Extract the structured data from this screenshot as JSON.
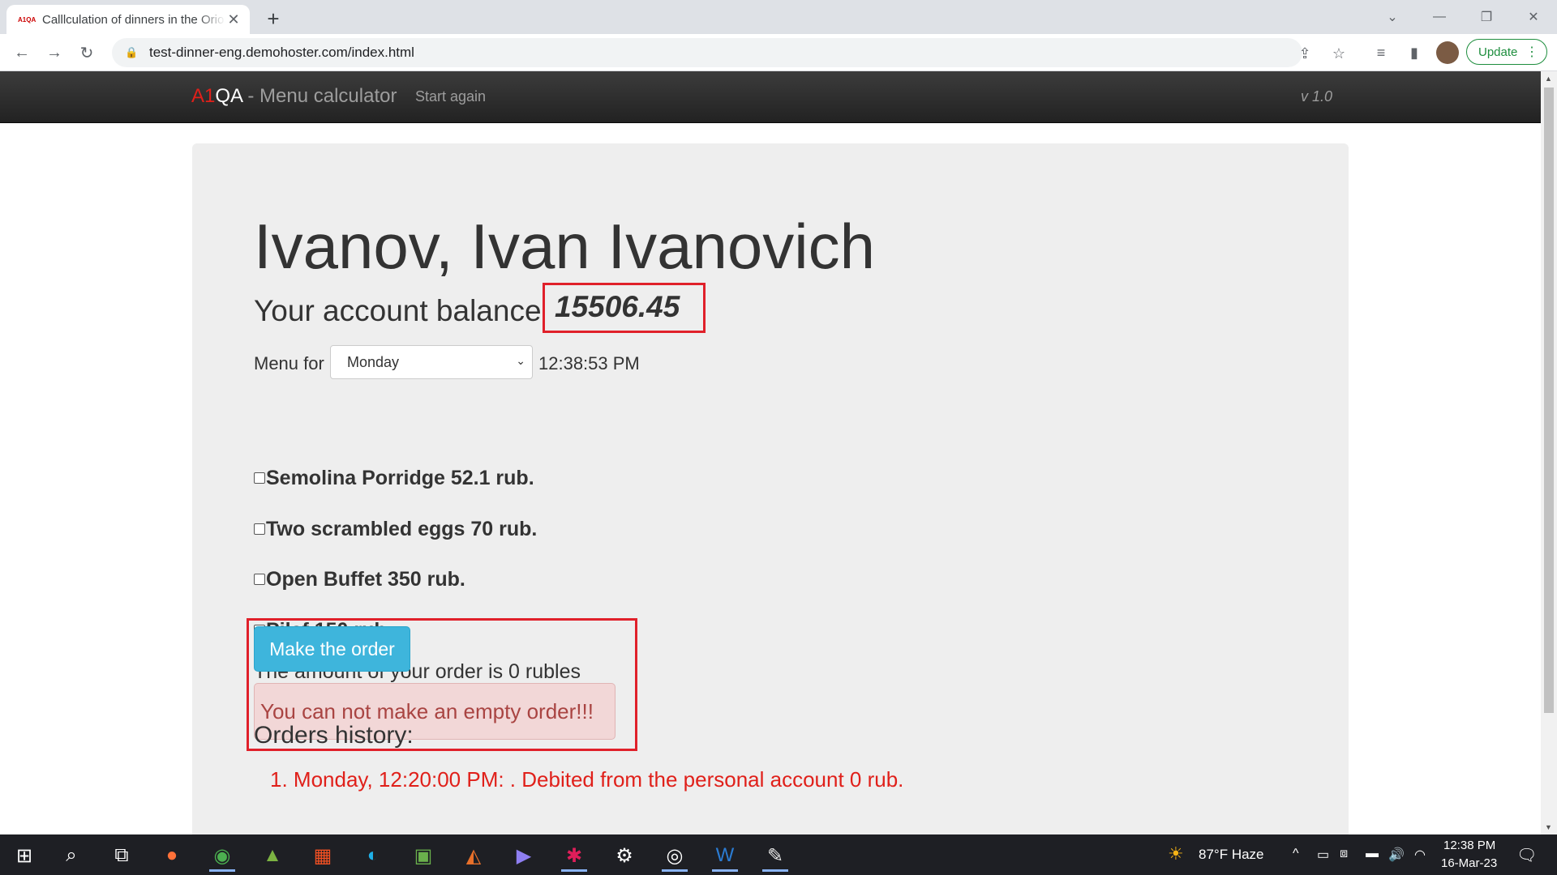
{
  "browser": {
    "tab_title": "Calllculation of dinners in the Orion",
    "favicon_text": "A1QA",
    "url": "test-dinner-eng.demohoster.com/index.html",
    "update_label": "Update"
  },
  "navbar": {
    "brand_a1": "A1",
    "brand_qa": "QA",
    "brand_rest": " - Menu calculator",
    "start_again": "Start again",
    "version": "v 1.0"
  },
  "page": {
    "user_name": "Ivanov, Ivan Ivanovich",
    "balance_label": "Your account balance",
    "balance_value": "15506.45",
    "menu_for_label": "Menu for",
    "selected_day": "Monday",
    "time": "12:38:53 PM",
    "dishes": [
      {
        "label": "Semolina Porridge 52.1 rub.",
        "checked": false
      },
      {
        "label": "Two scrambled eggs 70 rub.",
        "checked": false
      },
      {
        "label": "Open Buffet 350 rub.",
        "checked": false
      },
      {
        "label": "Pilaf 150 rub.",
        "checked": false
      }
    ],
    "order_sum": "The amount of your order is 0 rubles",
    "order_button": "Make the order",
    "alert_text": "You can not make an empty order!!!",
    "history_title": "Orders history:",
    "history_items": [
      "1. Monday, 12:20:00 PM: . Debited from the personal account 0 rub."
    ]
  },
  "taskbar": {
    "weather": "87°F  Haze",
    "clock_time": "12:38 PM",
    "clock_date": "16-Mar-23"
  },
  "colors": {
    "accent_red": "#e0202a",
    "button_blue": "#3eb5dc",
    "alert_bg": "#f2d7d7"
  }
}
